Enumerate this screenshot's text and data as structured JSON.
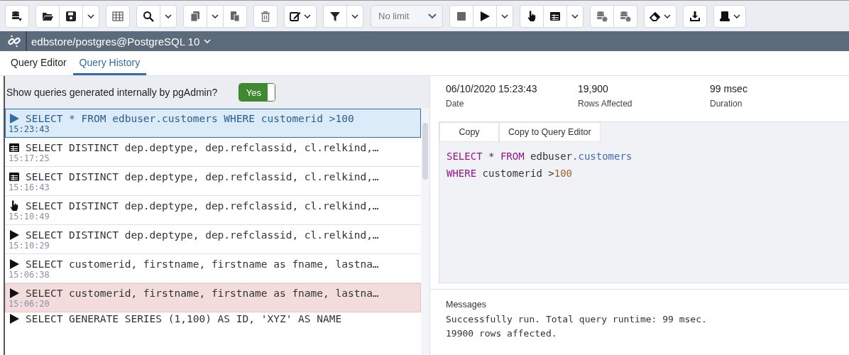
{
  "toolbar": {
    "row_limit": "No limit"
  },
  "connection": {
    "label": "edbstore/postgres@PostgreSQL 10"
  },
  "tabs": [
    {
      "label": "Query Editor",
      "selected": false
    },
    {
      "label": "Query History",
      "selected": true
    }
  ],
  "filter": {
    "label": "Show queries generated internally by pgAdmin?",
    "toggle": {
      "label": "Yes",
      "on": true
    }
  },
  "history": [
    {
      "kind": "run",
      "query": "SELECT * FROM edbuser.customers WHERE customerid >100",
      "time": "15:23:43",
      "selected": true,
      "error": false
    },
    {
      "kind": "table",
      "query": "SELECT DISTINCT dep.deptype, dep.refclassid, cl.relkind,…",
      "time": "15:17:25",
      "selected": false,
      "error": false
    },
    {
      "kind": "table",
      "query": "SELECT DISTINCT dep.deptype, dep.refclassid, cl.relkind,…",
      "time": "15:16:43",
      "selected": false,
      "error": false
    },
    {
      "kind": "pointer",
      "query": "SELECT DISTINCT dep.deptype, dep.refclassid, cl.relkind,…",
      "time": "15:10:49",
      "selected": false,
      "error": false
    },
    {
      "kind": "run",
      "query": "SELECT DISTINCT dep.deptype, dep.refclassid, cl.relkind,…",
      "time": "15:10:29",
      "selected": false,
      "error": false
    },
    {
      "kind": "run",
      "query": "SELECT customerid, firstname, firstname as fname, lastna…",
      "time": "15:06:38",
      "selected": false,
      "error": false
    },
    {
      "kind": "run",
      "query": "SELECT customerid, firstname, firstname as fname, lastna…",
      "time": "15:06:20",
      "selected": false,
      "error": true
    },
    {
      "kind": "run",
      "query": "SELECT GENERATE SERIES (1,100) AS ID, 'XYZ' AS NAME",
      "selected": false,
      "error": false
    }
  ],
  "details": {
    "stats": [
      {
        "value": "06/10/2020 15:23:43",
        "label": "Date"
      },
      {
        "value": "19,900",
        "label": "Rows Affected"
      },
      {
        "value": "99 msec",
        "label": "Duration"
      }
    ],
    "buttons": [
      "Copy",
      "Copy to Query Editor"
    ],
    "code": [
      [
        {
          "text": "SELECT",
          "kind": "keyword"
        },
        {
          "text": " * ",
          "kind": "plain"
        },
        {
          "text": "FROM",
          "kind": "keyword"
        },
        {
          "text": " edbuser",
          "kind": "plain"
        },
        {
          "text": ".customers",
          "kind": "identifier"
        }
      ],
      [
        {
          "text": "WHERE",
          "kind": "keyword"
        },
        {
          "text": " customerid >",
          "kind": "plain"
        },
        {
          "text": "100",
          "kind": "number"
        }
      ]
    ],
    "messages": {
      "title": "Messages",
      "lines": [
        "Successfully run. Total query runtime: 99 msec.",
        "19900 rows affected."
      ]
    }
  }
}
